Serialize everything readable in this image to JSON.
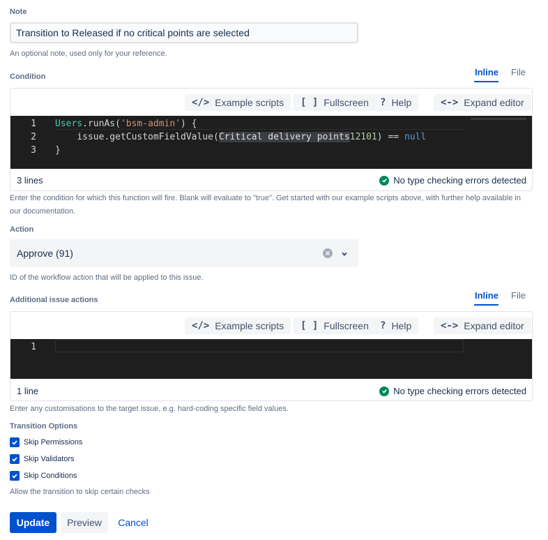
{
  "note": {
    "label": "Note",
    "value": "Transition to Released if no critical points are selected",
    "help": "An optional note, used only for your reference."
  },
  "condition": {
    "label": "Condition",
    "tabs": [
      {
        "label": "Inline",
        "active": true
      },
      {
        "label": "File",
        "active": false
      }
    ],
    "toolbar": {
      "example_scripts": "Example scripts",
      "fullscreen": "Fullscreen",
      "help": "Help",
      "expand_editor": "Expand editor"
    },
    "code": {
      "line_numbers": [
        "1",
        "2",
        "3"
      ],
      "lines": [
        {
          "ident": "Users",
          "pre": ".runAs(",
          "str": "'bsm-admin'",
          "post": ") {"
        },
        {
          "indent": "    ",
          "pre": "issue.getCustomFieldValue(",
          "highlight": "Critical delivery points",
          "num": "12101",
          "post": ") == ",
          "kw": "null"
        },
        {
          "text": "}"
        }
      ]
    },
    "status_lines": "3 lines",
    "status_check": "No type checking errors detected",
    "help": "Enter the condition for which this function will fire. Blank will evaluate to \"true\". Get started with our example scripts above, with further help available in our documentation."
  },
  "action": {
    "label": "Action",
    "selected": "Approve (91)",
    "help": "ID of the workflow action that will be applied to this issue."
  },
  "additional": {
    "label": "Additional issue actions",
    "tabs": [
      {
        "label": "Inline",
        "active": true
      },
      {
        "label": "File",
        "active": false
      }
    ],
    "toolbar": {
      "example_scripts": "Example scripts",
      "fullscreen": "Fullscreen",
      "help": "Help",
      "expand_editor": "Expand editor"
    },
    "code": {
      "line_numbers": [
        "1"
      ]
    },
    "status_lines": "1 line",
    "status_check": "No type checking errors detected",
    "help": "Enter any customisations to the target issue, e.g. hard-coding specific field values."
  },
  "transition_options": {
    "label": "Transition Options",
    "options": [
      {
        "label": "Skip Permissions",
        "checked": true
      },
      {
        "label": "Skip Validators",
        "checked": true
      },
      {
        "label": "Skip Conditions",
        "checked": true
      }
    ],
    "help": "Allow the transition to skip certain checks"
  },
  "buttons": {
    "update": "Update",
    "preview": "Preview",
    "cancel": "Cancel"
  },
  "colors": {
    "primary": "#0052cc",
    "success": "#00875a",
    "editor_bg": "#1e1e1e"
  },
  "icons": {
    "code": "code-icon",
    "fullscreen": "fullscreen-icon",
    "help": "question-icon",
    "expand": "expand-arrows-icon",
    "clear": "clear-icon",
    "dropdown": "chevron-down-icon",
    "check": "check-icon"
  }
}
